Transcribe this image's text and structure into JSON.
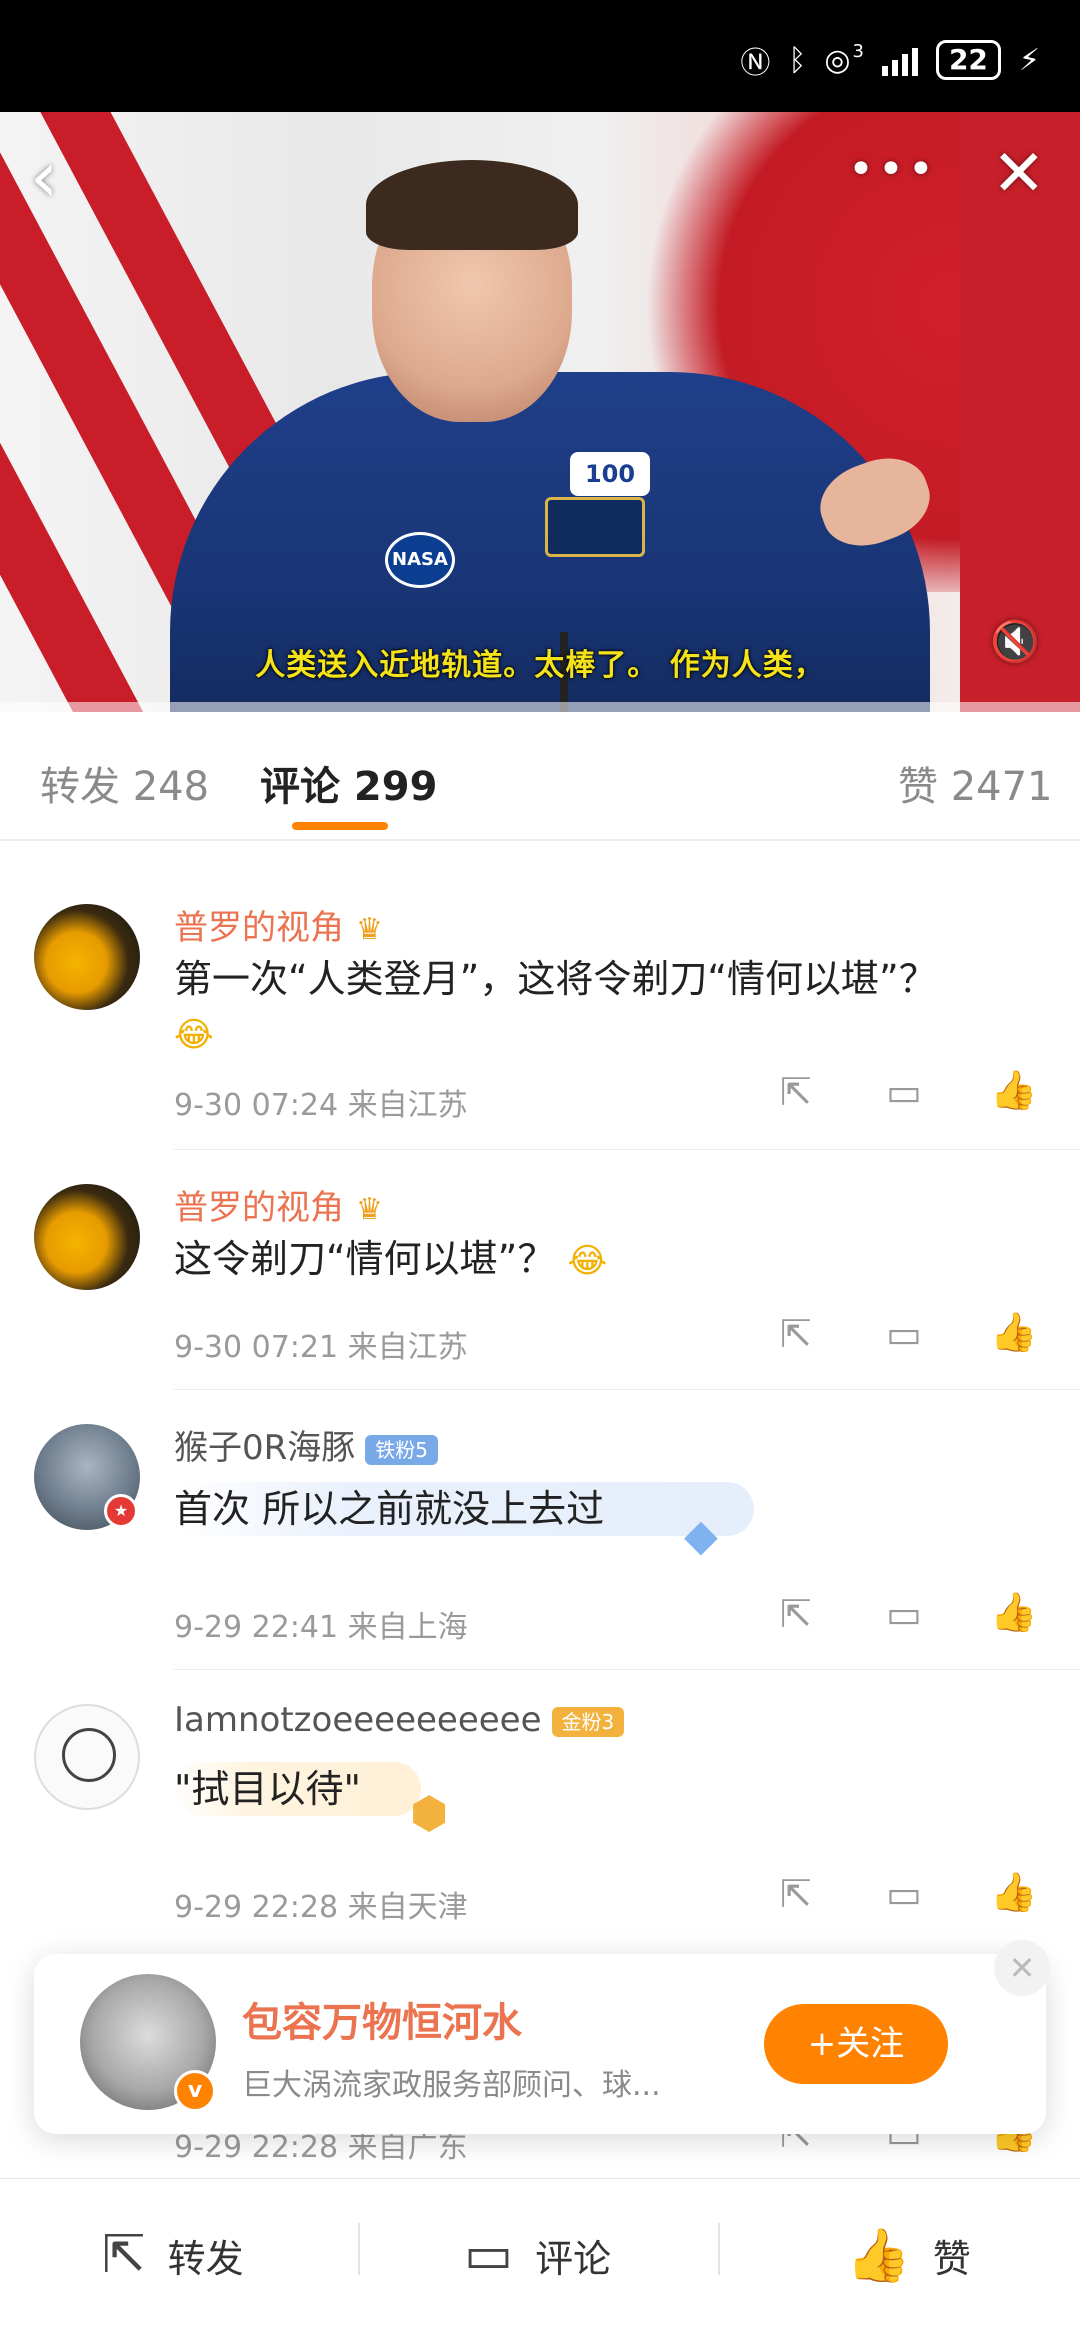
{
  "status_bar": {
    "battery": "22",
    "signal_sup": "3"
  },
  "video": {
    "subtitle": "人类送入近地轨道。太棒了。 作为人类，",
    "patch_nasa": "NASA",
    "patch_100": "100"
  },
  "tabs": [
    {
      "label": "转发 248"
    },
    {
      "label": "评论 299"
    },
    {
      "label": "赞 2471"
    }
  ],
  "comments": [
    {
      "user": "普罗的视角",
      "text": "第一次“人类登月”，这将令剃刀“情何以堪”？",
      "emoji": "😂",
      "meta": "9-30 07:24  来自江苏"
    },
    {
      "user": "普罗的视角",
      "text": "这令剃刀“情何以堪”？",
      "emoji": "😂",
      "meta": "9-30 07:21  来自江苏"
    },
    {
      "user": "猴子0R海豚",
      "badge": "铁粉5",
      "text": "首次 所以之前就没上去过",
      "meta": "9-29 22:41  来自上海"
    },
    {
      "user": "Iamnotzoeeeeeeeeee",
      "badge": "金粉3",
      "text": "\"拭目以待\"",
      "meta": "9-29 22:28  来自天津"
    },
    {
      "meta": "9-29 22:28  来自广东"
    }
  ],
  "follow_card": {
    "name": "包容万物恒河水",
    "desc": "巨大涡流家政服务部顾问、球...",
    "button": "+关注"
  },
  "bottom_bar": {
    "repost": "转发",
    "comment": "评论",
    "like": "赞"
  },
  "colors": {
    "accent": "#ff8200",
    "username": "#eb7350"
  },
  "icons": [
    "back-icon",
    "more-icon",
    "close-icon",
    "mute-icon",
    "share-icon",
    "comment-icon",
    "like-icon",
    "crown-icon",
    "gem-icon"
  ]
}
